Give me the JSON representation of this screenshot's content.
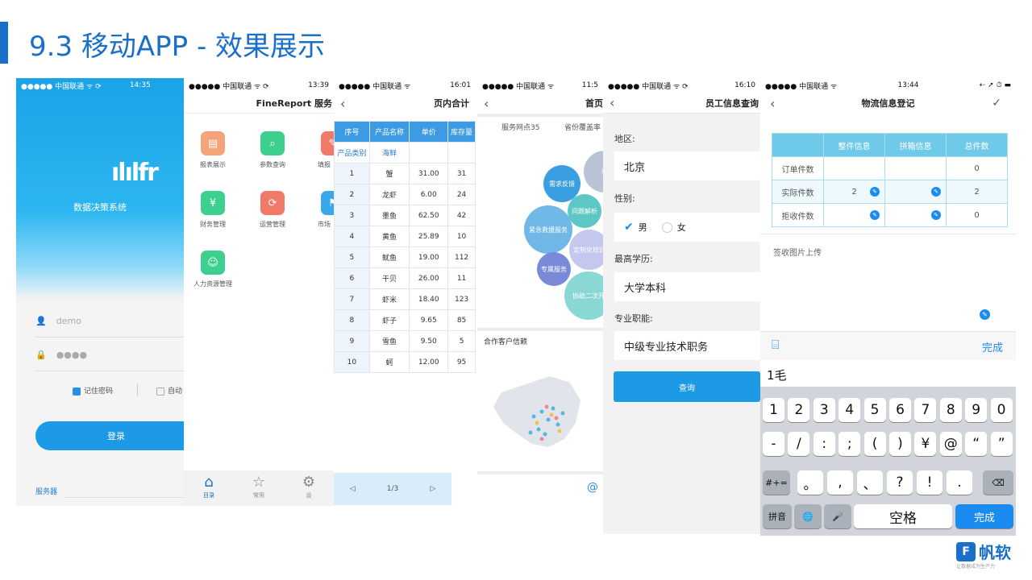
{
  "title": "9.3 移动APP - 效果展示",
  "p1": {
    "carrier": "●●●●● 中国联通 ᯤ ⟳",
    "time": "14:35",
    "app_logo": "ılılfr",
    "app_name": "数据决策系统",
    "username": "demo",
    "password": "●●●●",
    "remember": "记住密码",
    "auto": "自动",
    "login": "登录",
    "server": "服务器"
  },
  "p2": {
    "carrier": "●●●●● 中国联通 ᯤ ⟳",
    "time": "13:39",
    "title": "FineReport 服务",
    "items": [
      "报表展示",
      "参数查询",
      "填报",
      "财务管理",
      "运营管理",
      "市场",
      "人力资源管理"
    ],
    "tabs": [
      "目录",
      "常用",
      "设"
    ]
  },
  "p3": {
    "carrier": "●●●●● 中国联通 ᯤ",
    "time": "16:01",
    "title": "页内合计",
    "headers": [
      "序号",
      "产品名称",
      "单价",
      "库存量"
    ],
    "cat_label": "产品类别",
    "cat_value": "海鲜",
    "rows": [
      [
        "1",
        "蟹",
        "31.00",
        "31"
      ],
      [
        "2",
        "龙虾",
        "6.00",
        "24"
      ],
      [
        "3",
        "墨鱼",
        "62.50",
        "42"
      ],
      [
        "4",
        "黄鱼",
        "25.89",
        "10"
      ],
      [
        "5",
        "鱿鱼",
        "19.00",
        "112"
      ],
      [
        "6",
        "干贝",
        "26.00",
        "11"
      ],
      [
        "7",
        "虾米",
        "18.40",
        "123"
      ],
      [
        "8",
        "虾子",
        "9.65",
        "85"
      ],
      [
        "9",
        "雪鱼",
        "9.50",
        "5"
      ],
      [
        "10",
        "蚵",
        "12.00",
        "95"
      ]
    ],
    "page": "1/3"
  },
  "p4": {
    "carrier": "●●●●● 中国联通 ᯤ",
    "time": "11:5",
    "title": "首页",
    "stat1": "服务网点35",
    "stat2": "省份覆盖率",
    "bubbles": [
      "需求反馈",
      "问题解析",
      "紧急救援服务",
      "定制化培训",
      "专属服务",
      "协助二次开",
      "版"
    ],
    "section": "合作客户信赖",
    "at": "@"
  },
  "p5": {
    "carrier": "●●●●● 中国联通 ᯤ ⟳",
    "time": "16:10",
    "title": "员工信息查询",
    "region_label": "地区:",
    "region": "北京",
    "gender_label": "性别:",
    "male": "男",
    "female": "女",
    "edu_label": "最高学历:",
    "edu": "大学本科",
    "job_label": "专业职能:",
    "job": "中级专业技术职务",
    "query": "查询"
  },
  "p6": {
    "carrier": "●●●●● 中国联通 ᯤ",
    "time": "13:44",
    "status_right": "⇠ ➚ ⏱ ▬",
    "title": "物流信息登记",
    "headers": [
      "",
      "整件信息",
      "拼箱信息",
      "总件数"
    ],
    "rows": [
      [
        "订单件数",
        "",
        "",
        "0"
      ],
      [
        "实际件数",
        "2",
        "",
        "2"
      ],
      [
        "拒收件数",
        "",
        "",
        "0"
      ]
    ],
    "upload": "签收图片上传",
    "done": "完成",
    "input": "1毛",
    "keys_num": [
      "1",
      "2",
      "3",
      "4",
      "5",
      "6",
      "7",
      "8",
      "9",
      "0"
    ],
    "keys_sym": [
      "-",
      "/",
      ":",
      ";",
      "(",
      ")",
      "¥",
      "@",
      "“",
      "”"
    ],
    "keys_row3": [
      "#+=",
      "。",
      ",",
      "、",
      "?",
      "!",
      ".",
      "⌫"
    ],
    "keys_row4": [
      "拼音",
      "🌐",
      "🎤",
      "空格",
      "完成"
    ]
  },
  "brand": "帆软",
  "brand_sub": "让数据成为生产力"
}
